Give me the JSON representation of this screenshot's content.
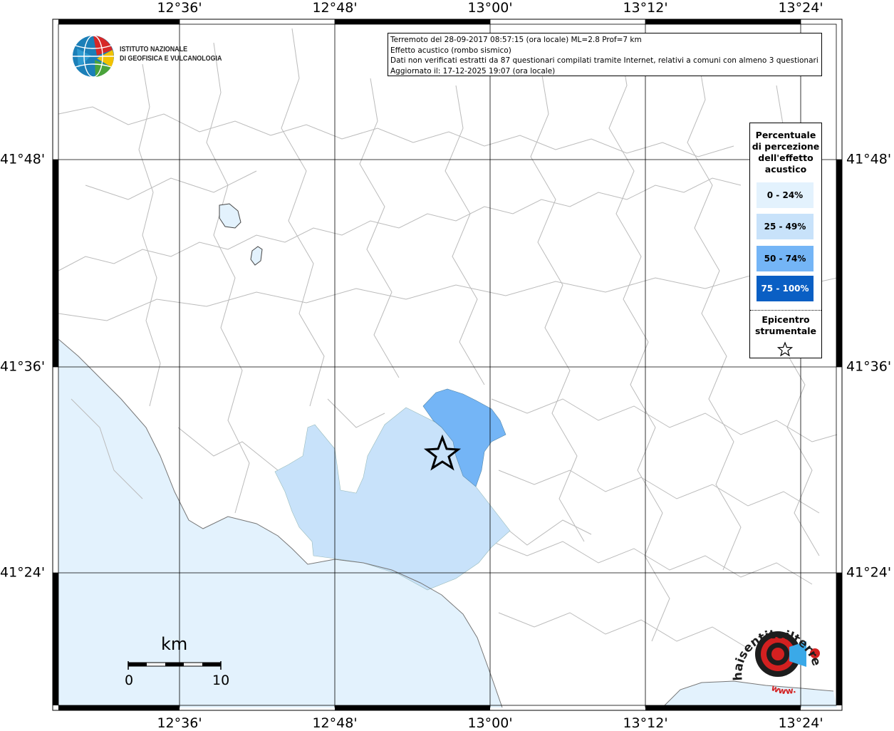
{
  "axes": {
    "top": [
      "12°36'",
      "12°48'",
      "13°00'",
      "13°12'",
      "13°24'"
    ],
    "bottom": [
      "12°36'",
      "12°48'",
      "13°00'",
      "13°12'",
      "13°24'"
    ],
    "left": [
      "41°48'",
      "41°36'",
      "41°24'"
    ],
    "right": [
      "41°48'",
      "41°36'",
      "41°24'"
    ]
  },
  "info": {
    "line1": "Terremoto del 28-09-2017 08:57:15 (ora locale) ML=2.8 Prof=7 km",
    "line2": "Effetto acustico (rombo sismico)",
    "line3": "Dati non verificati estratti da 87 questionari compilati tramite Internet, relativi a comuni con almeno 3 questionari.",
    "line4": "Aggiornato il: 17-12-2025 19:07 (ora locale)"
  },
  "logo": {
    "line1": "ISTITUTO NAZIONALE",
    "line2": "DI GEOFISICA E VULCANOLOGIA"
  },
  "legend": {
    "title_lines": [
      "Percentuale",
      "di percezione",
      "dell'effetto",
      "acustico"
    ],
    "classes": [
      {
        "label": "0 - 24%",
        "color": "#e3f2fd",
        "text_color": "#000000"
      },
      {
        "label": "25 - 49%",
        "color": "#c8e2fa",
        "text_color": "#000000"
      },
      {
        "label": "50 - 74%",
        "color": "#74b5f6",
        "text_color": "#000000"
      },
      {
        "label": "75 - 100%",
        "color": "#0a5fc4",
        "text_color": "#ffffff"
      }
    ],
    "epicenter_lines": [
      "Epicentro",
      "strumentale"
    ]
  },
  "scale": {
    "unit": "km",
    "ticks": [
      "0",
      "10"
    ]
  },
  "brand": {
    "text": "haisentitoilterremoto.it",
    "prefix": "www."
  },
  "colors": {
    "sea": "#e3f2fd",
    "class_25_49": "#c8e2fa",
    "class_50_74": "#74b5f6",
    "boundaries": "#b8b8b8",
    "grid": "#000000"
  }
}
